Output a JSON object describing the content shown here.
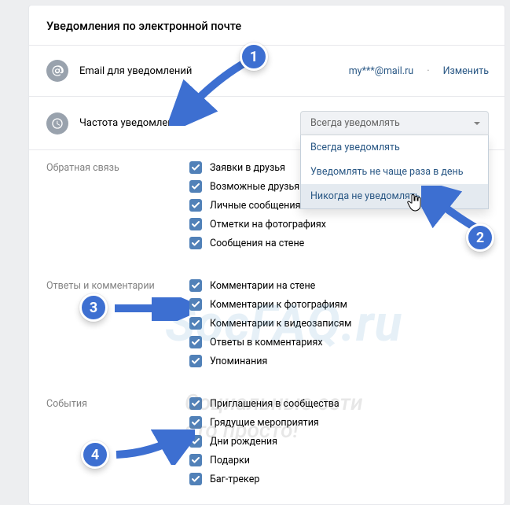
{
  "page_title": "Уведомления по электронной почте",
  "email_row": {
    "label": "Email для уведомлений",
    "value": "my***@mail.ru",
    "change": "Изменить"
  },
  "freq_row": {
    "label": "Частота уведомлений",
    "selected": "Всегда уведомлять",
    "options": [
      "Всегда уведомлять",
      "Уведомлять не чаще раза в день",
      "Никогда не уведомлять"
    ]
  },
  "sections": [
    {
      "title": "Обратная связь",
      "items": [
        "Заявки в друзья",
        "Возможные друзья",
        "Личные сообщения",
        "Отметки на фотографиях",
        "Сообщения на стене"
      ]
    },
    {
      "title": "Ответы и комментарии",
      "items": [
        "Комментарии на стене",
        "Комментарии к фотографиям",
        "Комментарии к видеозаписям",
        "Ответы в комментариях",
        "Упоминания"
      ]
    },
    {
      "title": "События",
      "items": [
        "Приглашения в сообщества",
        "Грядущие мероприятия",
        "Дни рождения",
        "Подарки",
        "Баг-трекер"
      ]
    }
  ],
  "watermark": {
    "big": "SocFAQ.ru",
    "line1": "Социальные сети",
    "line2": "это просто!"
  },
  "annotations": {
    "b1": "1",
    "b2": "2",
    "b3": "3",
    "b4": "4"
  }
}
